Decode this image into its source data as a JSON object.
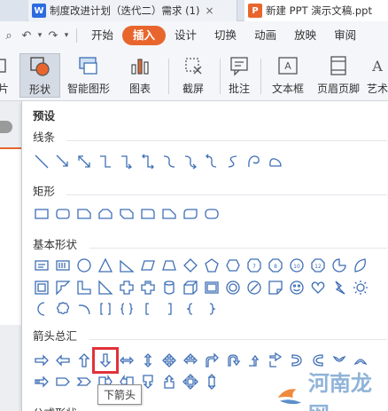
{
  "tabs": [
    {
      "label": "制度改进计划（迭代二）需求 (1)",
      "icon": "word-icon"
    },
    {
      "label": "新建 PPT 演示文稿.ppt",
      "icon": "ppt-icon"
    }
  ],
  "menu": {
    "items": [
      "开始",
      "插入",
      "设计",
      "切换",
      "动画",
      "放映",
      "审阅"
    ],
    "active": "插入"
  },
  "ribbon": {
    "buttons": [
      "片",
      "形状",
      "智能图形",
      "图表",
      "截屏",
      "批注",
      "文本框",
      "页眉页脚",
      "艺术"
    ]
  },
  "panel": {
    "title": "预设",
    "sections": [
      "线条",
      "矩形",
      "基本形状",
      "箭头总汇",
      "公式形状"
    ]
  },
  "tooltip": "下箭头",
  "watermark": "河南龙网",
  "colors": {
    "accent": "#e8662d",
    "highlight": "#e0323a",
    "shape_stroke": "#3f6fb5"
  }
}
